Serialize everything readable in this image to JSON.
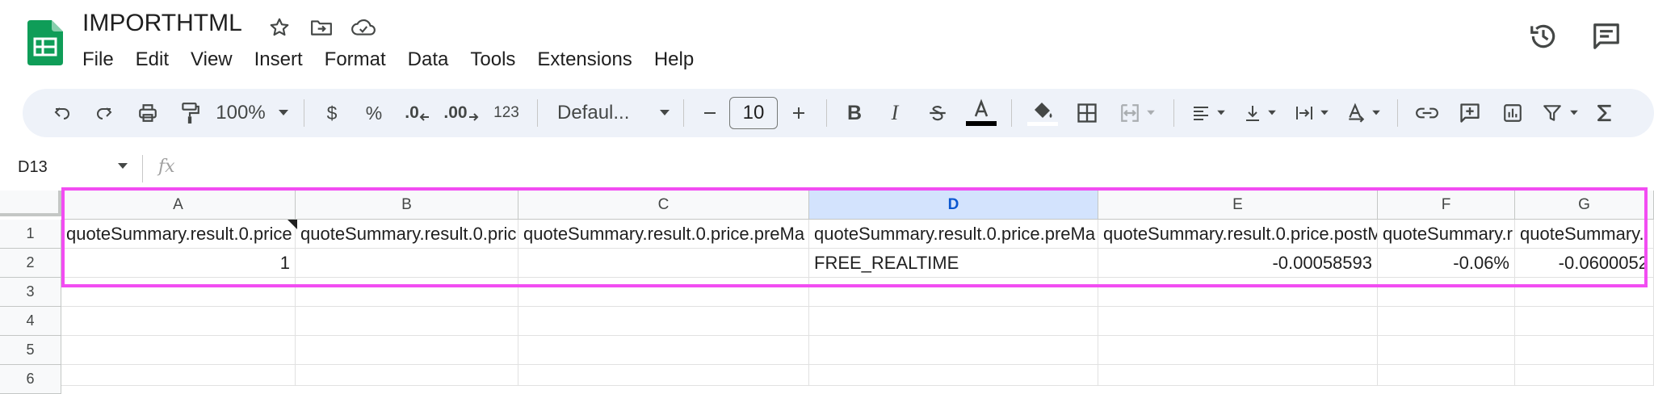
{
  "app": {
    "title": "IMPORTHTML",
    "menu": [
      "File",
      "Edit",
      "View",
      "Insert",
      "Format",
      "Data",
      "Tools",
      "Extensions",
      "Help"
    ]
  },
  "toolbar": {
    "zoom": "100%",
    "currency": "$",
    "percent": "%",
    "dec_decrease": ".0",
    "dec_increase": ".00",
    "number_format": "123",
    "font": "Defaul...",
    "font_size": "10",
    "bold": "B",
    "italic": "I"
  },
  "formula_bar": {
    "cell_ref": "D13",
    "fx": "fx"
  },
  "grid": {
    "columns": [
      "A",
      "B",
      "C",
      "D",
      "E",
      "F",
      "G"
    ],
    "selected_column": "D",
    "rows": [
      "1",
      "2",
      "3",
      "4",
      "5",
      "6"
    ],
    "row1": {
      "A": "quoteSummary.result.0.price",
      "B": "quoteSummary.result.0.pric",
      "C": "quoteSummary.result.0.price.preMa",
      "D": "quoteSummary.result.0.price.preMa",
      "E": "quoteSummary.result.0.price.postM",
      "F": "quoteSummary.r",
      "G": "quoteSummary."
    },
    "row2": {
      "A": "1",
      "B": "",
      "C": "",
      "D": "FREE_REALTIME",
      "E": "-0.00058593",
      "F": "-0.06%",
      "G": "-0.0600052"
    }
  },
  "colors": {
    "accent": "#0b57d0",
    "toolbar_bg": "#eef2f9",
    "selected_header": "#d3e3fd",
    "highlight": "#f24df2",
    "logo_green": "#0f9d58"
  }
}
